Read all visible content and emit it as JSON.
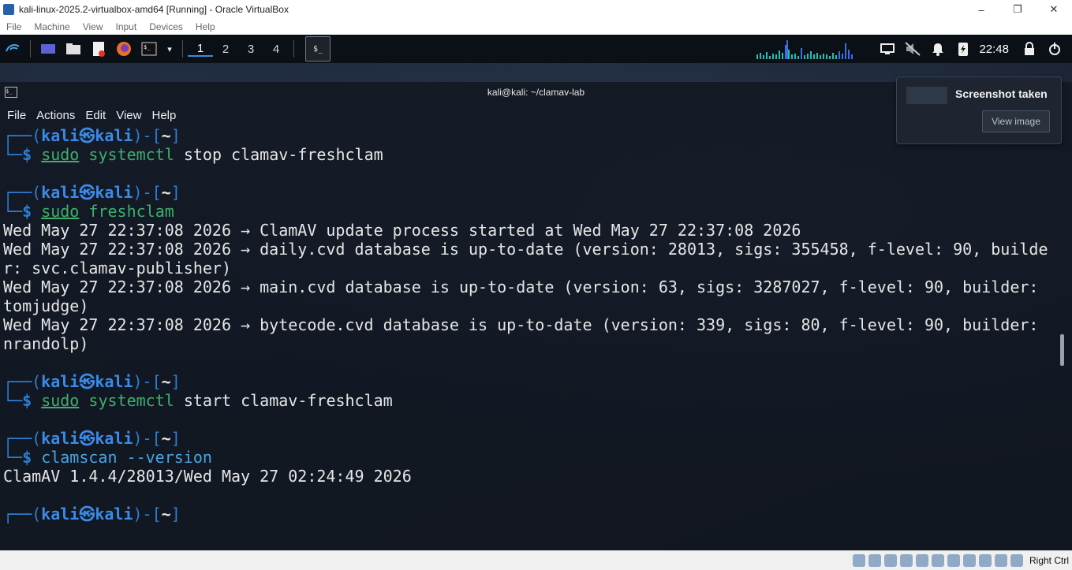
{
  "host": {
    "title": "kali-linux-2025.2-virtualbox-amd64 [Running] - Oracle VirtualBox",
    "menu": [
      "File",
      "Machine",
      "View",
      "Input",
      "Devices",
      "Help"
    ],
    "window_buttons": [
      "–",
      "❐",
      "✕"
    ],
    "host_key": "Right Ctrl"
  },
  "panel": {
    "workspaces": [
      "1",
      "2",
      "3",
      "4"
    ],
    "active_workspace": "1",
    "clock": "22:48"
  },
  "terminal": {
    "title": "kali@kali: ~/clamav-lab",
    "menu": [
      "File",
      "Actions",
      "Edit",
      "View",
      "Help"
    ],
    "prompt": {
      "tl": "┌──(",
      "user": "kali",
      "at": "㉿",
      "host": "kali",
      "mid": ")-[",
      "path": "~",
      "end": "]",
      "bl": "└─",
      "dollar": "$"
    },
    "blocks": [
      {
        "cmd": {
          "sudo": "sudo",
          "prog": "systemctl",
          "args": " stop clamav-freshclam"
        },
        "output": []
      },
      {
        "cmd": {
          "sudo": "sudo",
          "prog": "freshclam",
          "args": ""
        },
        "output": [
          "Wed May 27 22:37:08 2026 → ClamAV update process started at Wed May 27 22:37:08 2026",
          "Wed May 27 22:37:08 2026 → daily.cvd database is up-to-date (version: 28013, sigs: 355458, f-level: 90, builde",
          "r: svc.clamav-publisher)",
          "Wed May 27 22:37:08 2026 → main.cvd database is up-to-date (version: 63, sigs: 3287027, f-level: 90, builder:",
          "tomjudge)",
          "Wed May 27 22:37:08 2026 → bytecode.cvd database is up-to-date (version: 339, sigs: 80, f-level: 90, builder:",
          "nrandolp)"
        ]
      },
      {
        "cmd": {
          "sudo": "sudo",
          "prog": "systemctl",
          "args": " start clamav-freshclam"
        },
        "output": []
      },
      {
        "cmd": {
          "sudo": "",
          "prog": "clamscan --version",
          "args": ""
        },
        "output": [
          "ClamAV 1.4.4/28013/Wed May 27 02:24:49 2026"
        ]
      }
    ]
  },
  "notification": {
    "title": "Screenshot taken",
    "button": "View image"
  }
}
